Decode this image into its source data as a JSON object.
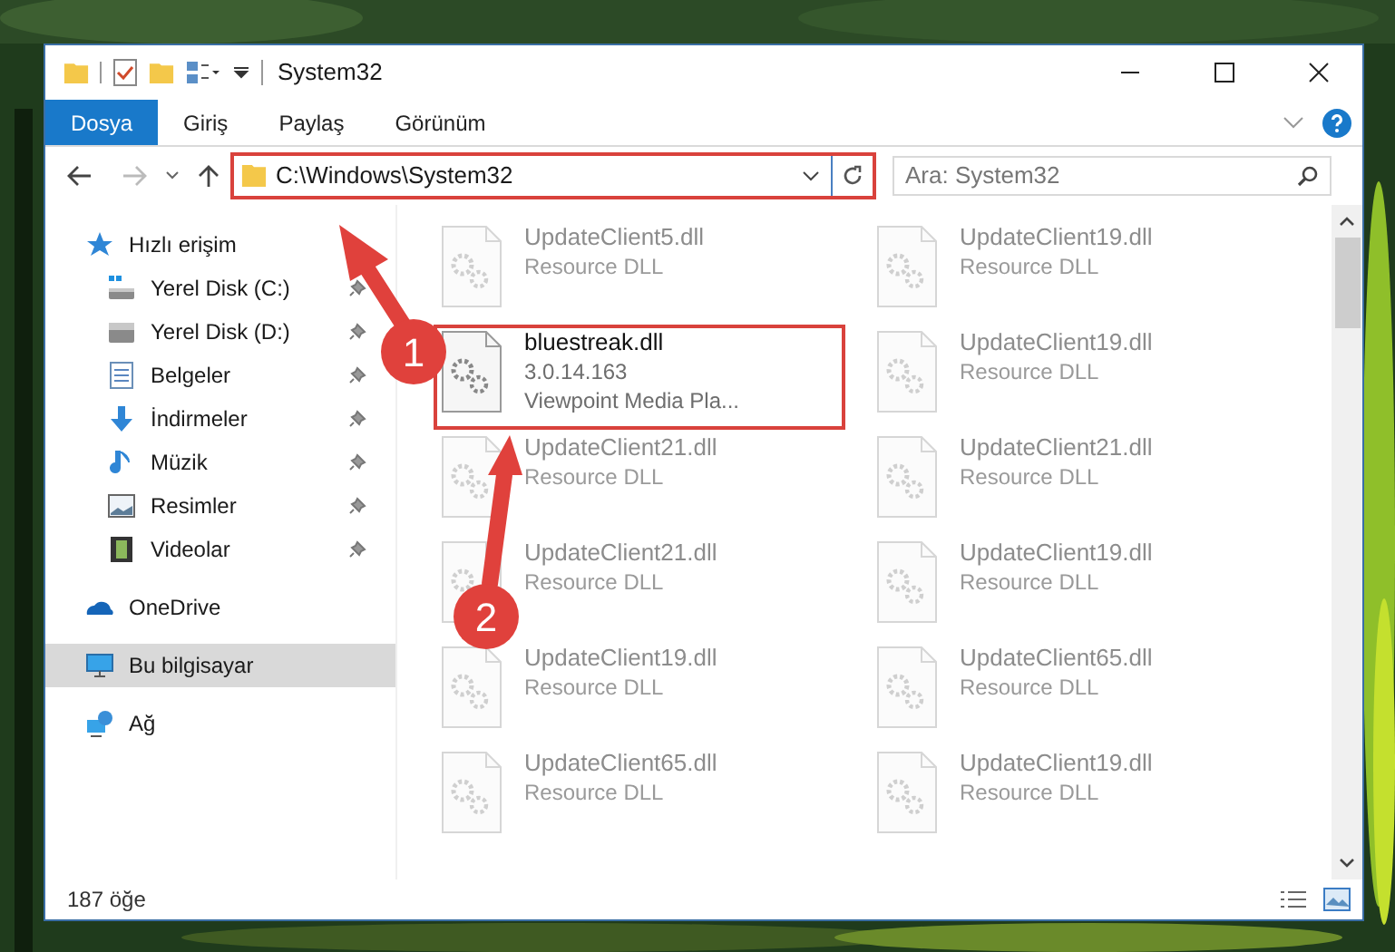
{
  "window": {
    "title": "System32"
  },
  "ribbon_tabs": [
    {
      "label": "Dosya",
      "selected": true
    },
    {
      "label": "Giriş",
      "selected": false
    },
    {
      "label": "Paylaş",
      "selected": false
    },
    {
      "label": "Görünüm",
      "selected": false
    }
  ],
  "address": {
    "path": "C:\\Windows\\System32",
    "highlighted": true
  },
  "search": {
    "placeholder": "Ara: System32"
  },
  "nav": [
    {
      "label": "Hızlı erişim",
      "kind": "star",
      "selected": false,
      "children": [
        {
          "label": "Yerel Disk (C:)",
          "kind": "system-drive",
          "pinned": true
        },
        {
          "label": "Yerel Disk (D:)",
          "kind": "drive",
          "pinned": true
        },
        {
          "label": "Belgeler",
          "kind": "documents",
          "pinned": true
        },
        {
          "label": "İndirmeler",
          "kind": "downloads",
          "pinned": true
        },
        {
          "label": "Müzik",
          "kind": "music",
          "pinned": true
        },
        {
          "label": "Resimler",
          "kind": "pictures",
          "pinned": true
        },
        {
          "label": "Videolar",
          "kind": "videos",
          "pinned": true
        }
      ]
    },
    {
      "label": "OneDrive",
      "kind": "cloud",
      "selected": false
    },
    {
      "label": "Bu bilgisayar",
      "kind": "computer",
      "selected": true
    },
    {
      "label": "Ağ",
      "kind": "network",
      "selected": false
    }
  ],
  "files": [
    {
      "name": "UpdateClient5.dll",
      "details": [
        "Resource DLL"
      ],
      "blurred": true,
      "highlighted": false
    },
    {
      "name": "UpdateClient19.dll",
      "details": [
        "Resource DLL"
      ],
      "blurred": true,
      "highlighted": false
    },
    {
      "name": "bluestreak.dll",
      "details": [
        "3.0.14.163",
        "Viewpoint Media Pla..."
      ],
      "blurred": false,
      "highlighted": true
    },
    {
      "name": "UpdateClient19.dll",
      "details": [
        "Resource DLL"
      ],
      "blurred": true,
      "highlighted": false
    },
    {
      "name": "UpdateClient21.dll",
      "details": [
        "Resource DLL"
      ],
      "blurred": true,
      "highlighted": false
    },
    {
      "name": "UpdateClient21.dll",
      "details": [
        "Resource DLL"
      ],
      "blurred": true,
      "highlighted": false
    },
    {
      "name": "UpdateClient21.dll",
      "details": [
        "Resource DLL"
      ],
      "blurred": true,
      "highlighted": false
    },
    {
      "name": "UpdateClient19.dll",
      "details": [
        "Resource DLL"
      ],
      "blurred": true,
      "highlighted": false
    },
    {
      "name": "UpdateClient19.dll",
      "details": [
        "Resource DLL"
      ],
      "blurred": true,
      "highlighted": false
    },
    {
      "name": "UpdateClient65.dll",
      "details": [
        "Resource DLL"
      ],
      "blurred": true,
      "highlighted": false
    },
    {
      "name": "UpdateClient65.dll",
      "details": [
        "Resource DLL"
      ],
      "blurred": true,
      "highlighted": false
    },
    {
      "name": "UpdateClient19.dll",
      "details": [
        "Resource DLL"
      ],
      "blurred": true,
      "highlighted": false
    }
  ],
  "status_bar": "187 öğe",
  "annotations": [
    {
      "label": "1"
    },
    {
      "label": "2"
    }
  ]
}
